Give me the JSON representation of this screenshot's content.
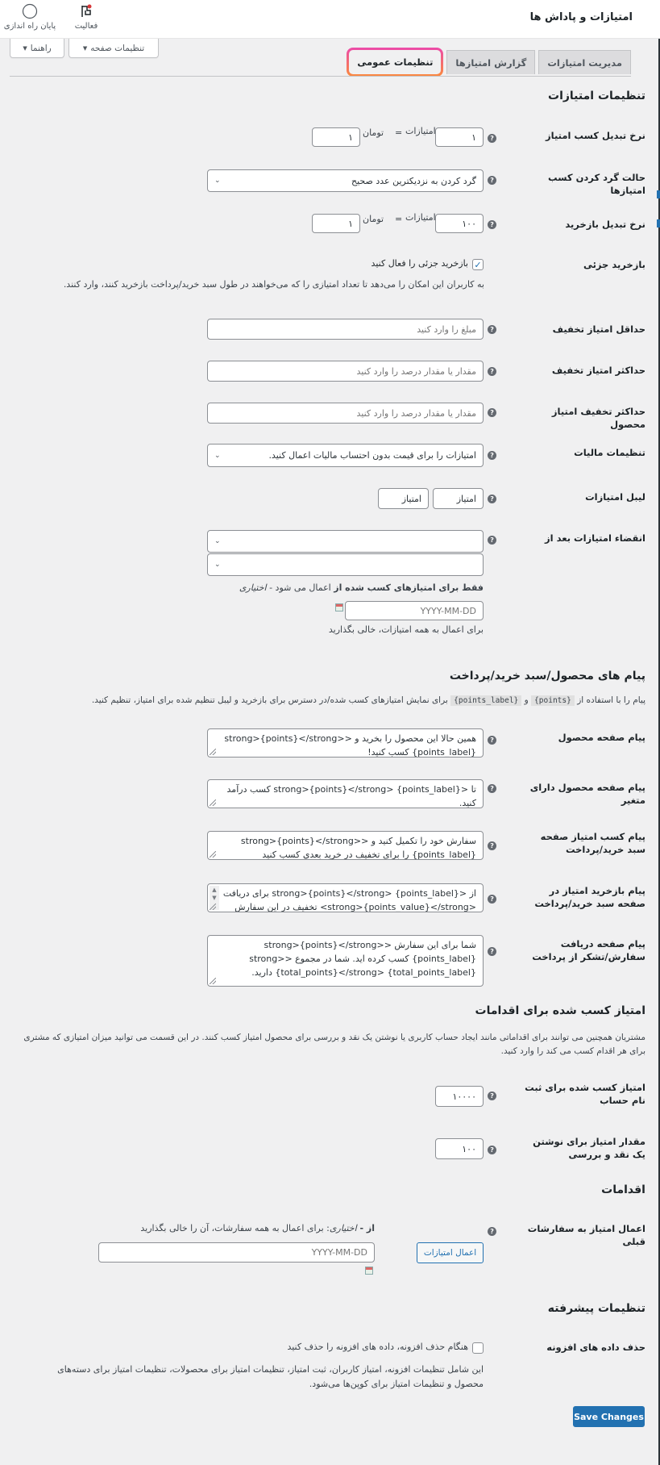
{
  "header": {
    "title": "امتیازات و پاداش ها",
    "tools": [
      {
        "label": "فعالیت",
        "icon": "flag-icon"
      },
      {
        "label": "پایان راه اندازی",
        "icon": "circle-icon"
      }
    ],
    "screen_options": {
      "label": "تنظیمات صفحه",
      "icon": "caret-down"
    },
    "help": {
      "label": "راهنما",
      "icon": "caret-down"
    }
  },
  "tabs": [
    {
      "label": "مدیریت امتیازات",
      "active": false
    },
    {
      "label": "گزارش امتیازها",
      "active": false
    },
    {
      "label": "تنظیمات عمومی",
      "active": true
    }
  ],
  "colors": {
    "primary": "#2271b1",
    "highlight_gradient": [
      "#ec4aa8",
      "#fb8a3c"
    ],
    "background": "#f0f0f1"
  },
  "points_settings": {
    "title": "تنظیمات امتیازات",
    "earn_conversion": {
      "label": "نرخ تبدیل کسب امتیاز",
      "points": "۱",
      "points_unit": "امتیازات",
      "equals": "=",
      "currency_unit": "تومان",
      "currency": "۱"
    },
    "rounding_mode": {
      "label": "حالت گرد کردن کسب امتیازها",
      "value": "گرد کردن به نزدیکترین عدد صحیح"
    },
    "redeem_conversion": {
      "label": "نرخ تبدیل بازخرید",
      "points": "۱۰۰",
      "points_unit": "امتیازات",
      "equals": "=",
      "currency_unit": "تومان",
      "currency": "۱"
    },
    "partial_redemption": {
      "label": "بازخرید جزئی",
      "checkbox_label": "بازخرید جزئی را فعال کنید",
      "checked": true,
      "description": "به کاربران این امکان را می‌دهد تا تعداد امتیازی را که می‌خواهند در طول سبد خرید/پرداخت بازخرید کنند، وارد کنند."
    },
    "min_discount": {
      "label": "حداقل امتیاز تخفیف",
      "placeholder": "مبلغ را وارد کنید",
      "value": ""
    },
    "max_discount": {
      "label": "حداکثر امتیاز تخفیف",
      "placeholder": "مقدار یا مقدار درصد را وارد کنید",
      "value": ""
    },
    "max_product_discount": {
      "label": "حداکثر تخفیف امتیاز محصول",
      "placeholder": "مقدار یا مقدار درصد را وارد کنید",
      "value": ""
    },
    "tax_settings": {
      "label": "تنظیمات مالیات",
      "value": "امتیازات را برای قیمت بدون احتساب مالیات اعمال کنید."
    },
    "points_label": {
      "label": "لیبل امتیازات",
      "singular": "امتیاز",
      "plural": "امتیاز"
    },
    "expiry": {
      "label": "انقضاء امتیازات بعد از",
      "select1": "",
      "select2": "",
      "note_bold1": "فقط",
      "note_mid": " برای امتیازهای کسب شده ",
      "note_bold2": "از",
      "note_rest": " اعمال می شود - ",
      "note_italic": "اختیاری",
      "date_placeholder": "YYYY-MM-DD",
      "hint": "برای اعمال به همه امتیازات، خالی بگذارید"
    }
  },
  "messages": {
    "title": "پیام های محصول/سبد خرید/پرداخت",
    "desc_pre": "پیام را با استفاده از",
    "tag_points": "{points}",
    "desc_and": "و",
    "tag_points_label": "{points_label}",
    "desc_post": "برای نمایش امتیازهای کسب شده/در دسترس برای بازخرید و لیبل تنظیم شده برای امتیاز، تنظیم کنید.",
    "product_page": {
      "label": "پیام صفحه محصول",
      "value": "همین حالا این محصول را بخرید و <strong>{points}</strong> {points_label} کسب کنید!"
    },
    "variable_product": {
      "label": "پیام صفحه محصول دارای متغیر",
      "value": "تا <strong>{points}</strong> {points_label} کسب درآمد کنید."
    },
    "cart_earn": {
      "label": "پیام کسب امتیاز صفحه سبد خرید/پرداخت",
      "value": "سفارش خود را تکمیل کنید و <strong>{points}</strong> {points_label} را برای تخفیف در خرید بعدي کسب کنید"
    },
    "cart_redeem": {
      "label": "پیام بازخرید امتیاز در صفحه سبد خرید/پرداخت",
      "value": "از <strong>{points}</strong> {points_label} برای دریافت <strong>{points_value}</strong> تخفیف در این سفارش"
    },
    "thank_you": {
      "label": "پیام صفحه دریافت سفارش/تشکر از پرداخت",
      "value": "شما برای این سفارش <strong>{points}</strong> {points_label} کسب کرده اید. شما در مجموع <strong>{total_points}</strong> {total_points_label} دارید."
    }
  },
  "actions_points": {
    "title": "امتیاز کسب شده برای اقدامات",
    "description": "مشتریان همچنین می توانند برای اقداماتی مانند ایجاد حساب کاربری یا نوشتن یک نقد و بررسی برای محصول امتیاز کسب کنند. در این قسمت می توانید میزان امتیازی که مشتری برای هر اقدام کسب می کند را وارد کنید.",
    "signup": {
      "label": "امتیاز کسب شده برای ثبت نام حساب",
      "value": "۱۰۰۰۰"
    },
    "review": {
      "label": "مقدار امتیاز برای نوشتن یک نقد و بررسی",
      "value": "۱۰۰"
    }
  },
  "actions": {
    "title": "اقدامات",
    "apply_previous": {
      "label": "اعمال امتیاز به سفارشات قبلی",
      "button": "اعمال امتیازات",
      "note_bold": "از - ",
      "note_italic": "اختیاری",
      "note_rest": ": برای اعمال به همه سفارشات، آن را خالی بگذارید",
      "date_placeholder": "YYYY-MM-DD"
    }
  },
  "advanced": {
    "title": "تنظیمات پیشرفته",
    "delete_data": {
      "label": "حذف داده های افزونه",
      "checkbox_label": "هنگام حذف افزونه، داده های افزونه را حذف کنید",
      "checked": false,
      "description": "این شامل تنظیمات افزونه، امتیاز کاربران، ثبت امتیاز، تنظیمات امتیاز برای محصولات، تنظیمات امتیاز برای دسته‌های محصول و تنظیمات امتیاز برای کوپن‌ها می‌شود."
    }
  },
  "save_button": "Save Changes"
}
